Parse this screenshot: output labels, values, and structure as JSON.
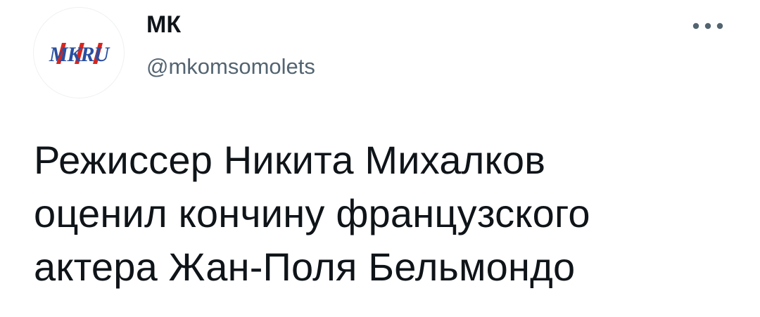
{
  "tweet": {
    "author": {
      "display_name": "МК",
      "handle": "@mkomsomolets",
      "avatar_logo_text": "MKRU",
      "avatar_icon": "mk-ru-logo"
    },
    "more_icon": "more-horizontal-icon",
    "text_lines": [
      "Режиссер Никита Михалков",
      "оценил кончину французского",
      "актера Жан-Поля Бельмондо"
    ]
  },
  "colors": {
    "text_primary": "#0f1419",
    "text_secondary": "#536471",
    "logo_blue": "#2a4fa0",
    "logo_red": "#d7261e",
    "background": "#ffffff"
  }
}
